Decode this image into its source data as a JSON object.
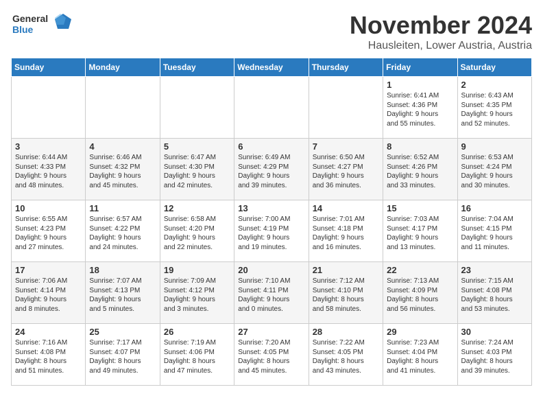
{
  "logo": {
    "line1": "General",
    "line2": "Blue"
  },
  "header": {
    "month": "November 2024",
    "location": "Hausleiten, Lower Austria, Austria"
  },
  "weekdays": [
    "Sunday",
    "Monday",
    "Tuesday",
    "Wednesday",
    "Thursday",
    "Friday",
    "Saturday"
  ],
  "weeks": [
    [
      {
        "day": "",
        "info": ""
      },
      {
        "day": "",
        "info": ""
      },
      {
        "day": "",
        "info": ""
      },
      {
        "day": "",
        "info": ""
      },
      {
        "day": "",
        "info": ""
      },
      {
        "day": "1",
        "info": "Sunrise: 6:41 AM\nSunset: 4:36 PM\nDaylight: 9 hours\nand 55 minutes."
      },
      {
        "day": "2",
        "info": "Sunrise: 6:43 AM\nSunset: 4:35 PM\nDaylight: 9 hours\nand 52 minutes."
      }
    ],
    [
      {
        "day": "3",
        "info": "Sunrise: 6:44 AM\nSunset: 4:33 PM\nDaylight: 9 hours\nand 48 minutes."
      },
      {
        "day": "4",
        "info": "Sunrise: 6:46 AM\nSunset: 4:32 PM\nDaylight: 9 hours\nand 45 minutes."
      },
      {
        "day": "5",
        "info": "Sunrise: 6:47 AM\nSunset: 4:30 PM\nDaylight: 9 hours\nand 42 minutes."
      },
      {
        "day": "6",
        "info": "Sunrise: 6:49 AM\nSunset: 4:29 PM\nDaylight: 9 hours\nand 39 minutes."
      },
      {
        "day": "7",
        "info": "Sunrise: 6:50 AM\nSunset: 4:27 PM\nDaylight: 9 hours\nand 36 minutes."
      },
      {
        "day": "8",
        "info": "Sunrise: 6:52 AM\nSunset: 4:26 PM\nDaylight: 9 hours\nand 33 minutes."
      },
      {
        "day": "9",
        "info": "Sunrise: 6:53 AM\nSunset: 4:24 PM\nDaylight: 9 hours\nand 30 minutes."
      }
    ],
    [
      {
        "day": "10",
        "info": "Sunrise: 6:55 AM\nSunset: 4:23 PM\nDaylight: 9 hours\nand 27 minutes."
      },
      {
        "day": "11",
        "info": "Sunrise: 6:57 AM\nSunset: 4:22 PM\nDaylight: 9 hours\nand 24 minutes."
      },
      {
        "day": "12",
        "info": "Sunrise: 6:58 AM\nSunset: 4:20 PM\nDaylight: 9 hours\nand 22 minutes."
      },
      {
        "day": "13",
        "info": "Sunrise: 7:00 AM\nSunset: 4:19 PM\nDaylight: 9 hours\nand 19 minutes."
      },
      {
        "day": "14",
        "info": "Sunrise: 7:01 AM\nSunset: 4:18 PM\nDaylight: 9 hours\nand 16 minutes."
      },
      {
        "day": "15",
        "info": "Sunrise: 7:03 AM\nSunset: 4:17 PM\nDaylight: 9 hours\nand 13 minutes."
      },
      {
        "day": "16",
        "info": "Sunrise: 7:04 AM\nSunset: 4:15 PM\nDaylight: 9 hours\nand 11 minutes."
      }
    ],
    [
      {
        "day": "17",
        "info": "Sunrise: 7:06 AM\nSunset: 4:14 PM\nDaylight: 9 hours\nand 8 minutes."
      },
      {
        "day": "18",
        "info": "Sunrise: 7:07 AM\nSunset: 4:13 PM\nDaylight: 9 hours\nand 5 minutes."
      },
      {
        "day": "19",
        "info": "Sunrise: 7:09 AM\nSunset: 4:12 PM\nDaylight: 9 hours\nand 3 minutes."
      },
      {
        "day": "20",
        "info": "Sunrise: 7:10 AM\nSunset: 4:11 PM\nDaylight: 9 hours\nand 0 minutes."
      },
      {
        "day": "21",
        "info": "Sunrise: 7:12 AM\nSunset: 4:10 PM\nDaylight: 8 hours\nand 58 minutes."
      },
      {
        "day": "22",
        "info": "Sunrise: 7:13 AM\nSunset: 4:09 PM\nDaylight: 8 hours\nand 56 minutes."
      },
      {
        "day": "23",
        "info": "Sunrise: 7:15 AM\nSunset: 4:08 PM\nDaylight: 8 hours\nand 53 minutes."
      }
    ],
    [
      {
        "day": "24",
        "info": "Sunrise: 7:16 AM\nSunset: 4:08 PM\nDaylight: 8 hours\nand 51 minutes."
      },
      {
        "day": "25",
        "info": "Sunrise: 7:17 AM\nSunset: 4:07 PM\nDaylight: 8 hours\nand 49 minutes."
      },
      {
        "day": "26",
        "info": "Sunrise: 7:19 AM\nSunset: 4:06 PM\nDaylight: 8 hours\nand 47 minutes."
      },
      {
        "day": "27",
        "info": "Sunrise: 7:20 AM\nSunset: 4:05 PM\nDaylight: 8 hours\nand 45 minutes."
      },
      {
        "day": "28",
        "info": "Sunrise: 7:22 AM\nSunset: 4:05 PM\nDaylight: 8 hours\nand 43 minutes."
      },
      {
        "day": "29",
        "info": "Sunrise: 7:23 AM\nSunset: 4:04 PM\nDaylight: 8 hours\nand 41 minutes."
      },
      {
        "day": "30",
        "info": "Sunrise: 7:24 AM\nSunset: 4:03 PM\nDaylight: 8 hours\nand 39 minutes."
      }
    ]
  ]
}
